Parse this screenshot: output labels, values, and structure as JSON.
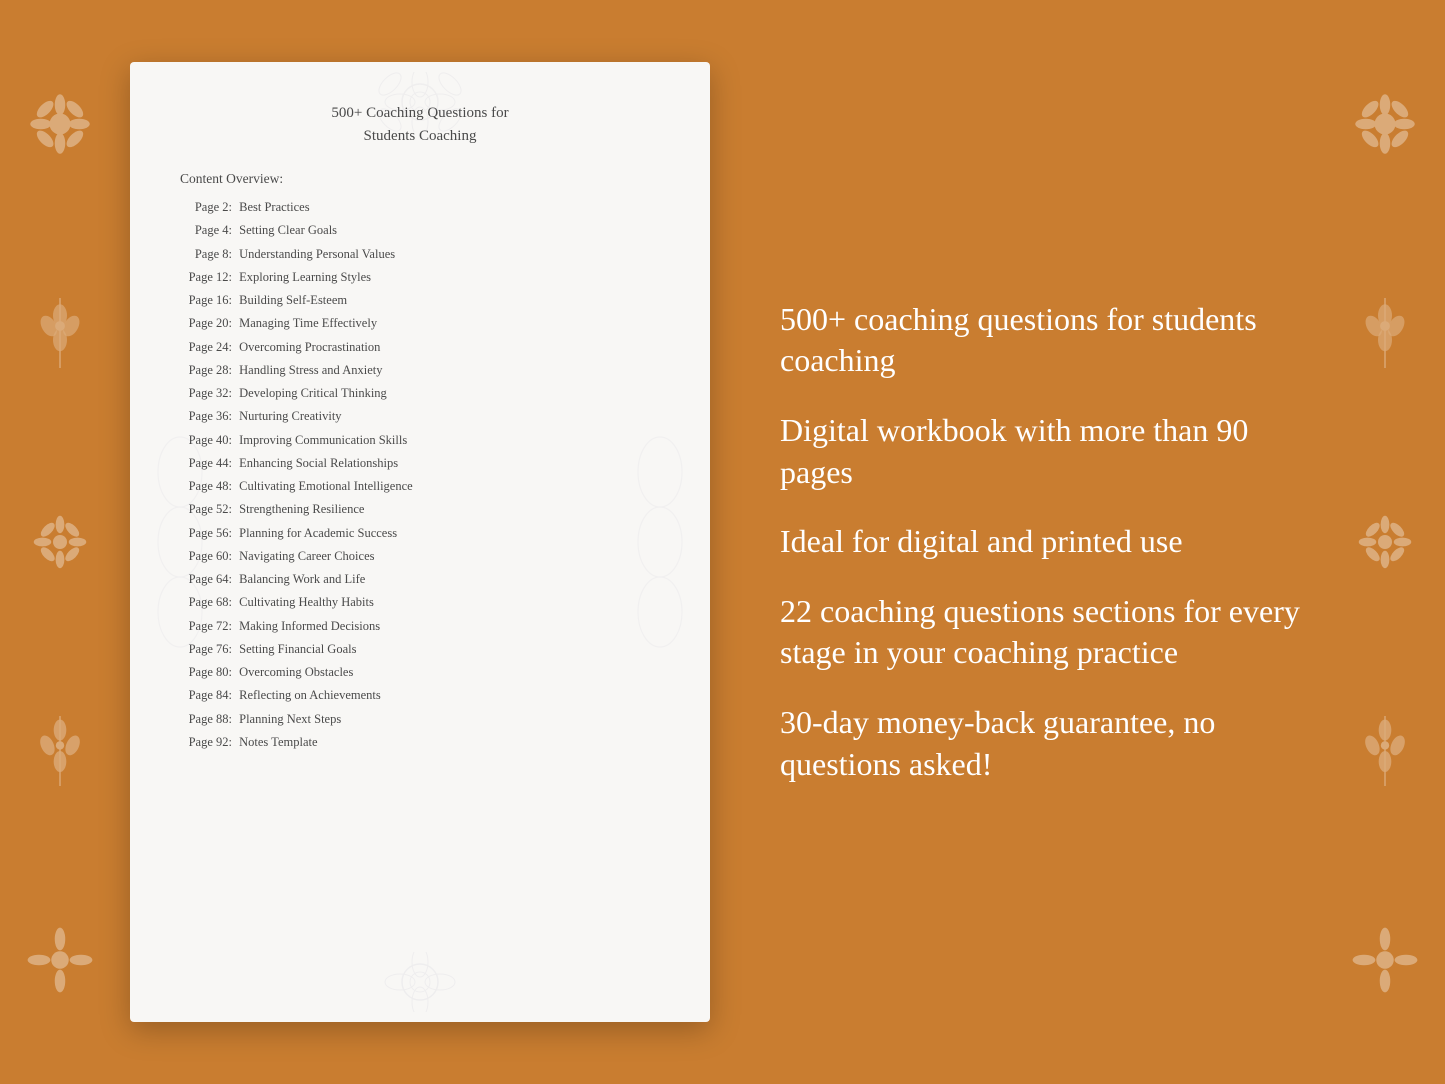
{
  "background_color": "#C97D30",
  "document": {
    "title_line1": "500+ Coaching Questions for",
    "title_line2": "Students Coaching",
    "content_overview_label": "Content Overview:",
    "toc_items": [
      {
        "page": "Page  2:",
        "title": "Best Practices"
      },
      {
        "page": "Page  4:",
        "title": "Setting Clear Goals"
      },
      {
        "page": "Page  8:",
        "title": "Understanding Personal Values"
      },
      {
        "page": "Page 12:",
        "title": "Exploring Learning Styles"
      },
      {
        "page": "Page 16:",
        "title": "Building Self-Esteem"
      },
      {
        "page": "Page 20:",
        "title": "Managing Time Effectively"
      },
      {
        "page": "Page 24:",
        "title": "Overcoming Procrastination"
      },
      {
        "page": "Page 28:",
        "title": "Handling Stress and Anxiety"
      },
      {
        "page": "Page 32:",
        "title": "Developing Critical Thinking"
      },
      {
        "page": "Page 36:",
        "title": "Nurturing Creativity"
      },
      {
        "page": "Page 40:",
        "title": "Improving Communication Skills"
      },
      {
        "page": "Page 44:",
        "title": "Enhancing Social Relationships"
      },
      {
        "page": "Page 48:",
        "title": "Cultivating Emotional Intelligence"
      },
      {
        "page": "Page 52:",
        "title": "Strengthening Resilience"
      },
      {
        "page": "Page 56:",
        "title": "Planning for Academic Success"
      },
      {
        "page": "Page 60:",
        "title": "Navigating Career Choices"
      },
      {
        "page": "Page 64:",
        "title": "Balancing Work and Life"
      },
      {
        "page": "Page 68:",
        "title": "Cultivating Healthy Habits"
      },
      {
        "page": "Page 72:",
        "title": "Making Informed Decisions"
      },
      {
        "page": "Page 76:",
        "title": "Setting Financial Goals"
      },
      {
        "page": "Page 80:",
        "title": "Overcoming Obstacles"
      },
      {
        "page": "Page 84:",
        "title": "Reflecting on Achievements"
      },
      {
        "page": "Page 88:",
        "title": "Planning Next Steps"
      },
      {
        "page": "Page 92:",
        "title": "Notes Template"
      }
    ]
  },
  "features": [
    "500+ coaching questions for students coaching",
    "Digital workbook with more than 90 pages",
    "Ideal for digital and printed use",
    "22 coaching questions sections for every stage in your coaching practice",
    "30-day money-back guarantee, no questions asked!"
  ]
}
